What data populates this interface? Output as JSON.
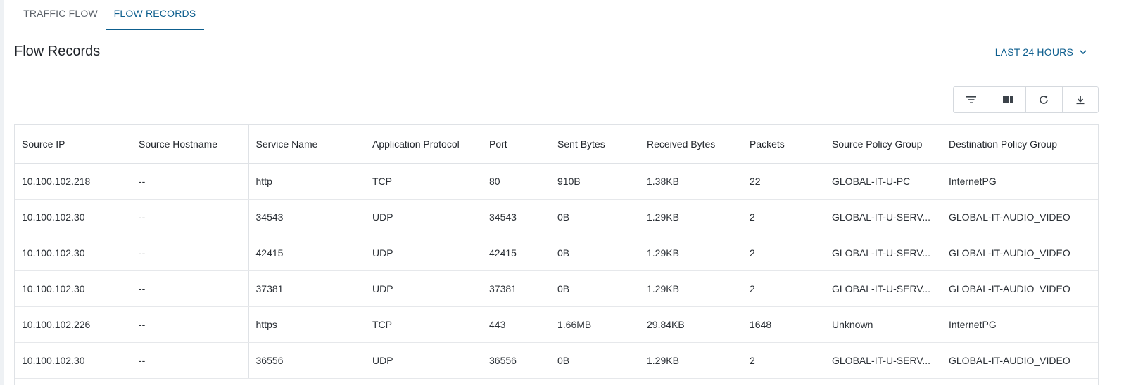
{
  "tabs": [
    {
      "label": "TRAFFIC FLOW",
      "active": false
    },
    {
      "label": "FLOW RECORDS",
      "active": true
    }
  ],
  "page": {
    "title": "Flow Records",
    "time_range": "LAST 24 HOURS"
  },
  "toolbar": {
    "buttons": [
      "filter-icon",
      "columns-icon",
      "refresh-icon",
      "download-icon"
    ]
  },
  "colors": {
    "accent": "#0d5e8e",
    "border": "#dfe2e6"
  },
  "table": {
    "columns": [
      "Source IP",
      "Source Hostname",
      "Service Name",
      "Application Protocol",
      "Port",
      "Sent Bytes",
      "Received Bytes",
      "Packets",
      "Source Policy Group",
      "Destination Policy Group"
    ],
    "rows": [
      [
        "10.100.102.218",
        "--",
        "http",
        "TCP",
        "80",
        "910B",
        "1.38KB",
        "22",
        "GLOBAL-IT-U-PC",
        "InternetPG"
      ],
      [
        "10.100.102.30",
        "--",
        "34543",
        "UDP",
        "34543",
        "0B",
        "1.29KB",
        "2",
        "GLOBAL-IT-U-SERV...",
        "GLOBAL-IT-AUDIO_VIDEO"
      ],
      [
        "10.100.102.30",
        "--",
        "42415",
        "UDP",
        "42415",
        "0B",
        "1.29KB",
        "2",
        "GLOBAL-IT-U-SERV...",
        "GLOBAL-IT-AUDIO_VIDEO"
      ],
      [
        "10.100.102.30",
        "--",
        "37381",
        "UDP",
        "37381",
        "0B",
        "1.29KB",
        "2",
        "GLOBAL-IT-U-SERV...",
        "GLOBAL-IT-AUDIO_VIDEO"
      ],
      [
        "10.100.102.226",
        "--",
        "https",
        "TCP",
        "443",
        "1.66MB",
        "29.84KB",
        "1648",
        "Unknown",
        "InternetPG"
      ],
      [
        "10.100.102.30",
        "--",
        "36556",
        "UDP",
        "36556",
        "0B",
        "1.29KB",
        "2",
        "GLOBAL-IT-U-SERV...",
        "GLOBAL-IT-AUDIO_VIDEO"
      ]
    ]
  }
}
